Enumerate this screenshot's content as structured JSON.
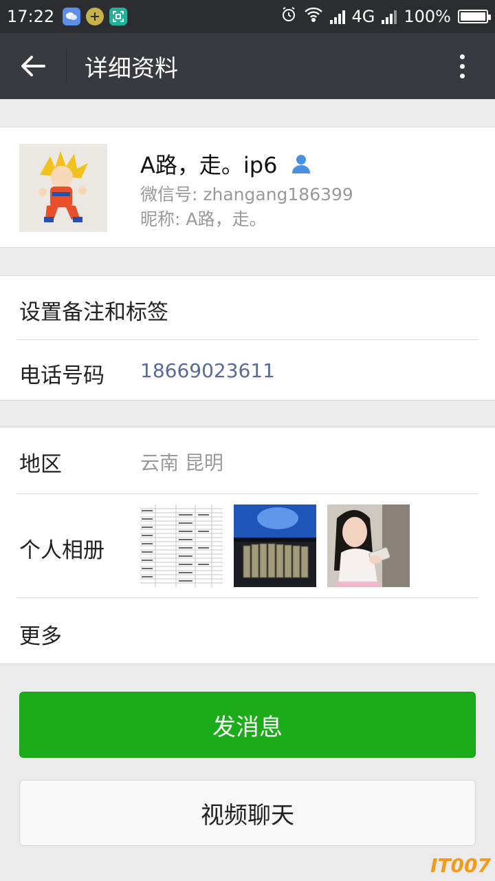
{
  "status_bar": {
    "time": "17:22",
    "network": "4G",
    "battery": "100%",
    "battery_level": 1.0
  },
  "nav": {
    "title": "详细资料"
  },
  "profile": {
    "name": "A路，走。ip6",
    "wechat_id": "微信号: zhangang186399",
    "nickname": "昵称: A路，走。"
  },
  "rows": {
    "remark_label": "设置备注和标签",
    "phone_label": "电话号码",
    "phone_value": "18669023611",
    "region_label": "地区",
    "region_value": "云南  昆明",
    "album_label": "个人相册",
    "more_label": "更多"
  },
  "buttons": {
    "send_message": "发消息",
    "video_chat": "视频聊天"
  },
  "watermark": "IT007",
  "colors": {
    "primary_green": "#1aad19",
    "nav_bg": "#393a3f",
    "phone_link": "#576b95"
  }
}
